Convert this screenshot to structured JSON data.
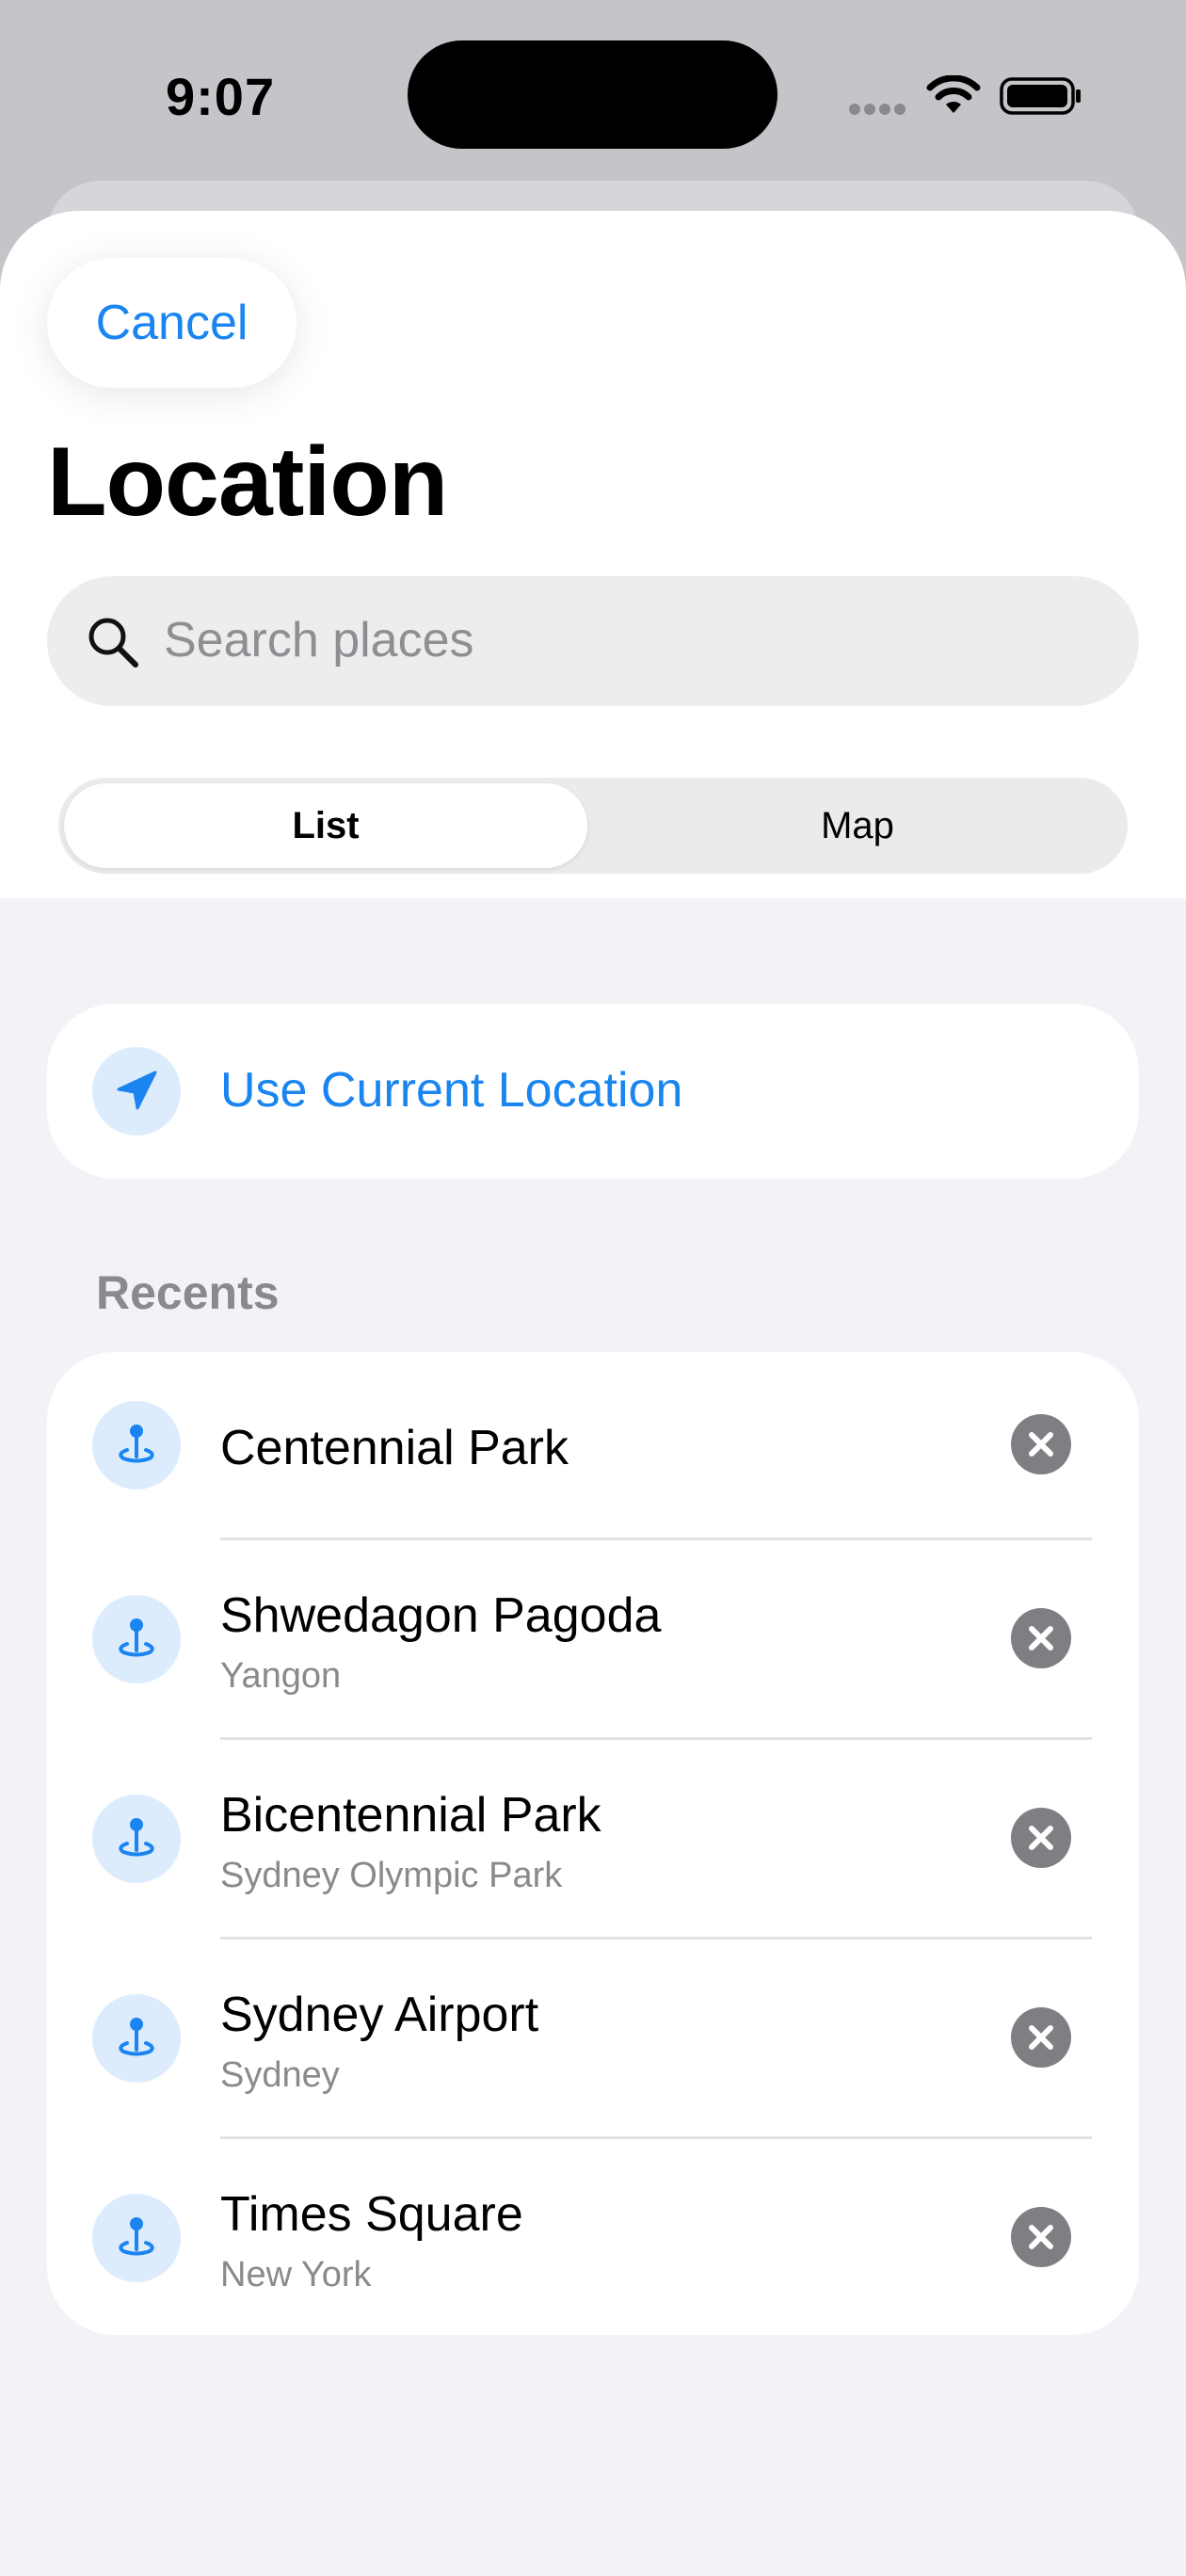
{
  "status_bar": {
    "time": "9:07"
  },
  "sheet": {
    "cancel_label": "Cancel",
    "title": "Location",
    "search": {
      "placeholder": "Search places"
    },
    "segments": [
      {
        "label": "List",
        "selected": true
      },
      {
        "label": "Map",
        "selected": false
      }
    ],
    "use_current_location_label": "Use Current Location",
    "recents_header": "Recents",
    "recents": [
      {
        "name": "Centennial Park",
        "subtitle": ""
      },
      {
        "name": "Shwedagon Pagoda",
        "subtitle": "Yangon"
      },
      {
        "name": "Bicentennial Park",
        "subtitle": "Sydney Olympic Park"
      },
      {
        "name": "Sydney Airport",
        "subtitle": "Sydney"
      },
      {
        "name": "Times Square",
        "subtitle": "New York"
      }
    ]
  },
  "colors": {
    "accent": "#1a84f0",
    "badge_bg": "#dcecfd",
    "grouped_bg": "#f2f2f7"
  }
}
